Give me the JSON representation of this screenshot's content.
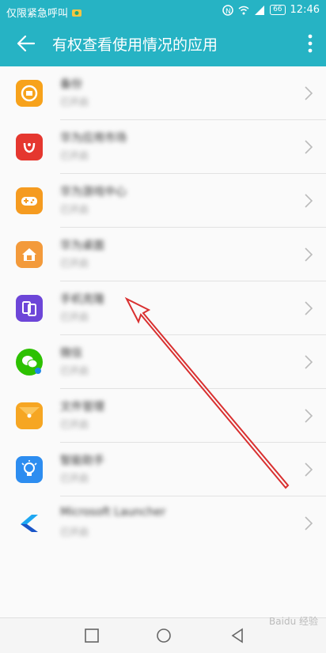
{
  "status_bar": {
    "left_text": "仅限紧急呼叫",
    "battery": "66",
    "time": "12:46"
  },
  "app_bar": {
    "title": "有权查看使用情况的应用"
  },
  "apps": [
    {
      "name": "备份",
      "status": "已开启",
      "color": "#f7a21b"
    },
    {
      "name": "华为应用市场",
      "status": "已开启",
      "color": "#e5372f"
    },
    {
      "name": "华为游戏中心",
      "status": "已开启",
      "color": "#f59b20"
    },
    {
      "name": "华为桌面",
      "status": "已开启",
      "color": "#f39a3b"
    },
    {
      "name": "手机克隆",
      "status": "已开启",
      "color": "#6d46d8"
    },
    {
      "name": "微信",
      "status": "已开启",
      "color": "#2dc100"
    },
    {
      "name": "文件管理",
      "status": "已开启",
      "color": "#f6a623"
    },
    {
      "name": "智能助手",
      "status": "已开启",
      "color": "#2d8df0"
    },
    {
      "name": "Microsoft Launcher",
      "status": "已开启",
      "color": "#1a73e8"
    }
  ],
  "watermark": "Baidu 经验"
}
